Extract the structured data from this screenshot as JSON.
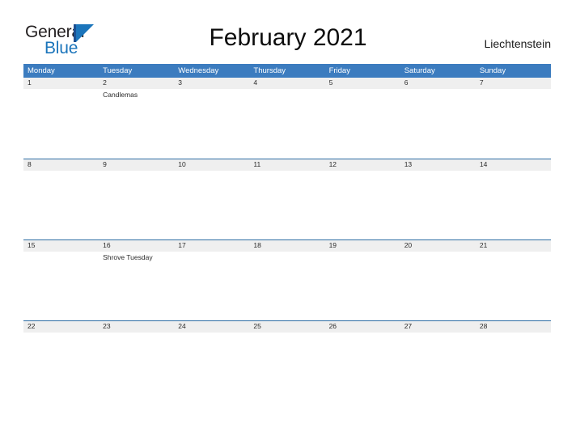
{
  "brand": {
    "name_part1": "General",
    "name_part2": "Blue",
    "mark_icon": "triangle-flag-icon",
    "accent_color": "#1b75bb",
    "dark_color": "#1b4f91"
  },
  "header": {
    "title": "February 2021",
    "country": "Liechtenstein"
  },
  "calendar": {
    "header_bg": "#3c7cbf",
    "band_bg": "#efefef",
    "rule_color": "#2e6da4",
    "weekdays": [
      "Monday",
      "Tuesday",
      "Wednesday",
      "Thursday",
      "Friday",
      "Saturday",
      "Sunday"
    ],
    "weeks": [
      [
        {
          "date": "1",
          "events": []
        },
        {
          "date": "2",
          "events": [
            "Candlemas"
          ]
        },
        {
          "date": "3",
          "events": []
        },
        {
          "date": "4",
          "events": []
        },
        {
          "date": "5",
          "events": []
        },
        {
          "date": "6",
          "events": []
        },
        {
          "date": "7",
          "events": []
        }
      ],
      [
        {
          "date": "8",
          "events": []
        },
        {
          "date": "9",
          "events": []
        },
        {
          "date": "10",
          "events": []
        },
        {
          "date": "11",
          "events": []
        },
        {
          "date": "12",
          "events": []
        },
        {
          "date": "13",
          "events": []
        },
        {
          "date": "14",
          "events": []
        }
      ],
      [
        {
          "date": "15",
          "events": []
        },
        {
          "date": "16",
          "events": [
            "Shrove Tuesday"
          ]
        },
        {
          "date": "17",
          "events": []
        },
        {
          "date": "18",
          "events": []
        },
        {
          "date": "19",
          "events": []
        },
        {
          "date": "20",
          "events": []
        },
        {
          "date": "21",
          "events": []
        }
      ],
      [
        {
          "date": "22",
          "events": []
        },
        {
          "date": "23",
          "events": []
        },
        {
          "date": "24",
          "events": []
        },
        {
          "date": "25",
          "events": []
        },
        {
          "date": "26",
          "events": []
        },
        {
          "date": "27",
          "events": []
        },
        {
          "date": "28",
          "events": []
        }
      ]
    ]
  }
}
